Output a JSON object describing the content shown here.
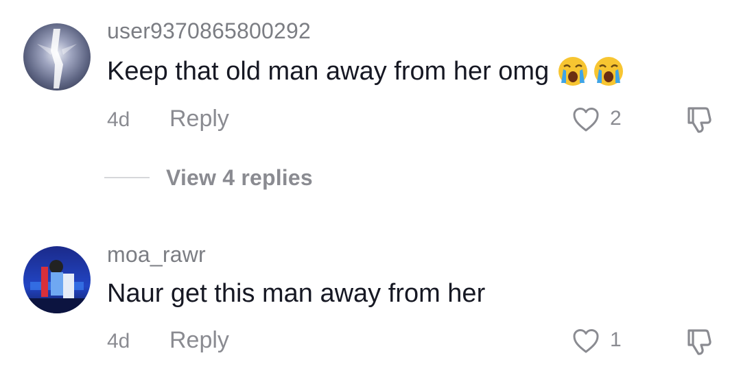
{
  "comments": [
    {
      "username": "user9370865800292",
      "text": "Keep that old man away from her omg",
      "emojis": [
        "crying-face-emoji",
        "crying-face-emoji"
      ],
      "age": "4d",
      "reply_label": "Reply",
      "likes": "2",
      "icons": {
        "like": "heart-outline-icon",
        "dislike": "thumbs-down-icon"
      }
    },
    {
      "username": "moa_rawr",
      "text": "Naur get this man away from her",
      "age": "4d",
      "reply_label": "Reply",
      "likes": "1",
      "icons": {
        "like": "heart-outline-icon",
        "dislike": "thumbs-down-icon"
      }
    }
  ],
  "view_replies": {
    "label": "View 4 replies"
  },
  "colors": {
    "text_primary": "#161823",
    "text_secondary": "#8a8b91",
    "divider": "#d6d7da"
  }
}
